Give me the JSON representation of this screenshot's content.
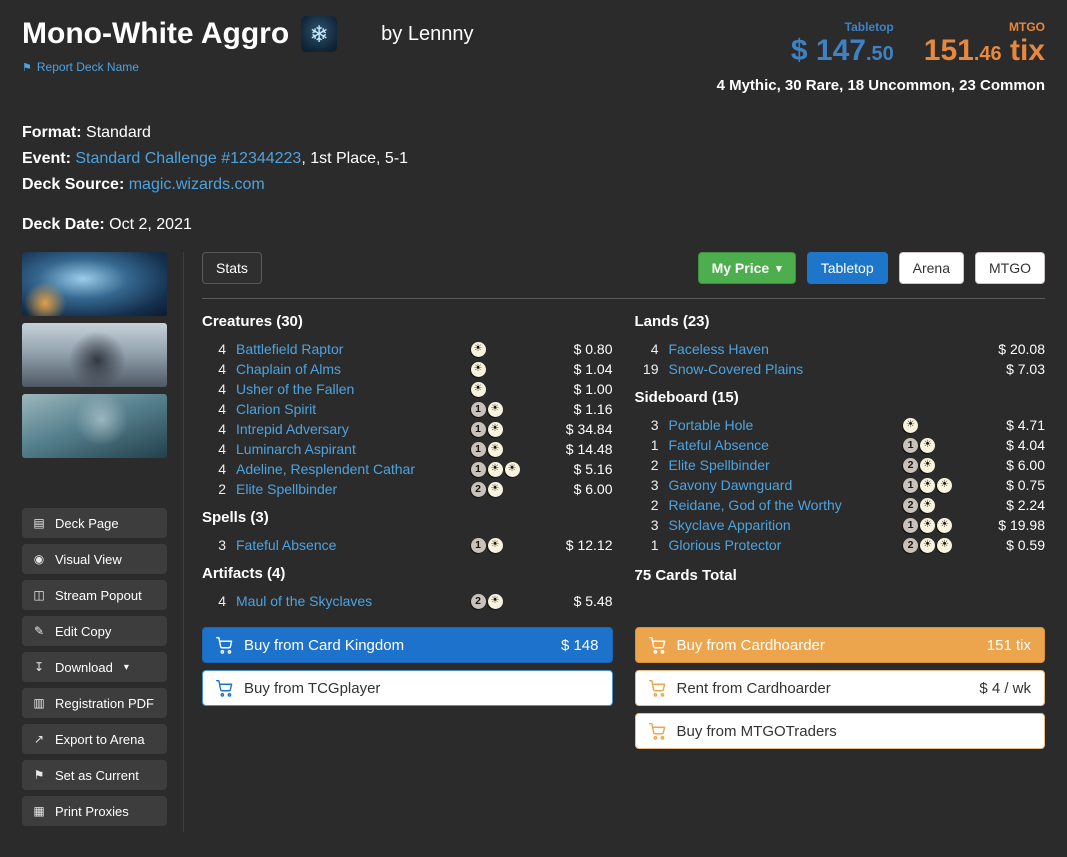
{
  "colors": {
    "background": "#2b2b2b",
    "link_blue": "#4da3e0",
    "tabletop_blue": "#3f82c4",
    "mtgo_orange": "#e8883c",
    "my_price_green": "#4cae4c",
    "active_tab_blue": "#1d76c9",
    "buy_blue": "#1d72cc",
    "buy_orange": "#eda54d",
    "mana_white": "#f7f3dc",
    "mana_generic": "#cac2ba"
  },
  "header": {
    "title": "Mono-White Aggro",
    "snow_icon_glyph": "❄",
    "author": "by Lennny",
    "report_flag_glyph": "⚑",
    "report_link": "Report Deck Name",
    "prices": {
      "tabletop": {
        "label": "Tabletop",
        "currency": "$ ",
        "whole": "147",
        "decimal": ".50"
      },
      "mtgo": {
        "label": "MTGO",
        "whole": "151",
        "decimal": ".46",
        "suffix": " tix"
      }
    },
    "rarity_summary": "4 Mythic, 30 Rare, 18 Uncommon, 23 Common"
  },
  "meta": {
    "format_label": "Format:",
    "format_value": "Standard",
    "event_label": "Event:",
    "event_link": "Standard Challenge #12344223",
    "event_suffix": ", 1st Place, 5-1",
    "source_label": "Deck Source:",
    "source_link": "magic.wizards.com",
    "date_label": "Deck Date:",
    "date_value": "Oct 2, 2021"
  },
  "sidebar": {
    "buttons": [
      {
        "label": "Deck Page",
        "glyph": "▤",
        "icon": "list-icon"
      },
      {
        "label": "Visual View",
        "glyph": "◉",
        "icon": "eye-icon"
      },
      {
        "label": "Stream Popout",
        "glyph": "◫",
        "icon": "popout-icon"
      },
      {
        "label": "Edit Copy",
        "glyph": "✎",
        "icon": "pencil-icon"
      },
      {
        "label": "Download",
        "glyph": "↧",
        "icon": "download-icon",
        "caret": true
      },
      {
        "label": "Registration PDF",
        "glyph": "▥",
        "icon": "document-icon"
      },
      {
        "label": "Export to Arena",
        "glyph": "↗",
        "icon": "export-icon"
      },
      {
        "label": "Set as Current",
        "glyph": "⚑",
        "icon": "flag-icon"
      },
      {
        "label": "Print Proxies",
        "glyph": "▦",
        "icon": "printer-icon"
      }
    ]
  },
  "toolbar": {
    "stats_label": "Stats",
    "my_price_label": "My Price",
    "caret_glyph": "▾",
    "tabletop_label": "Tabletop",
    "arena_label": "Arena",
    "mtgo_label": "MTGO"
  },
  "deck": {
    "columns": [
      {
        "sections": [
          {
            "title": "Creatures (30)",
            "cards": [
              {
                "qty": "4",
                "name": "Battlefield Raptor",
                "mana": [
                  "w"
                ],
                "price": "$ 0.80"
              },
              {
                "qty": "4",
                "name": "Chaplain of Alms",
                "mana": [
                  "w"
                ],
                "price": "$ 1.04"
              },
              {
                "qty": "4",
                "name": "Usher of the Fallen",
                "mana": [
                  "w"
                ],
                "price": "$ 1.00"
              },
              {
                "qty": "4",
                "name": "Clarion Spirit",
                "mana": [
                  "1",
                  "w"
                ],
                "price": "$ 1.16"
              },
              {
                "qty": "4",
                "name": "Intrepid Adversary",
                "mana": [
                  "1",
                  "w"
                ],
                "price": "$ 34.84"
              },
              {
                "qty": "4",
                "name": "Luminarch Aspirant",
                "mana": [
                  "1",
                  "w"
                ],
                "price": "$ 14.48"
              },
              {
                "qty": "4",
                "name": "Adeline, Resplendent Cathar",
                "mana": [
                  "1",
                  "w",
                  "w"
                ],
                "price": "$ 5.16"
              },
              {
                "qty": "2",
                "name": "Elite Spellbinder",
                "mana": [
                  "2",
                  "w"
                ],
                "price": "$ 6.00"
              }
            ]
          },
          {
            "title": "Spells (3)",
            "cards": [
              {
                "qty": "3",
                "name": "Fateful Absence",
                "mana": [
                  "1",
                  "w"
                ],
                "price": "$ 12.12"
              }
            ]
          },
          {
            "title": "Artifacts (4)",
            "cards": [
              {
                "qty": "4",
                "name": "Maul of the Skyclaves",
                "mana": [
                  "2",
                  "w"
                ],
                "price": "$ 5.48"
              }
            ]
          }
        ]
      },
      {
        "sections": [
          {
            "title": "Lands (23)",
            "cards": [
              {
                "qty": "4",
                "name": "Faceless Haven",
                "mana": [],
                "price": "$ 20.08"
              },
              {
                "qty": "19",
                "name": "Snow-Covered Plains",
                "mana": [],
                "price": "$ 7.03"
              }
            ]
          },
          {
            "title": "Sideboard (15)",
            "cards": [
              {
                "qty": "3",
                "name": "Portable Hole",
                "mana": [
                  "w"
                ],
                "price": "$ 4.71"
              },
              {
                "qty": "1",
                "name": "Fateful Absence",
                "mana": [
                  "1",
                  "w"
                ],
                "price": "$ 4.04"
              },
              {
                "qty": "2",
                "name": "Elite Spellbinder",
                "mana": [
                  "2",
                  "w"
                ],
                "price": "$ 6.00"
              },
              {
                "qty": "3",
                "name": "Gavony Dawnguard",
                "mana": [
                  "1",
                  "w",
                  "w"
                ],
                "price": "$ 0.75"
              },
              {
                "qty": "2",
                "name": "Reidane, God of the Worthy",
                "mana": [
                  "2",
                  "w"
                ],
                "price": "$ 2.24"
              },
              {
                "qty": "3",
                "name": "Skyclave Apparition",
                "mana": [
                  "1",
                  "w",
                  "w"
                ],
                "price": "$ 19.98"
              },
              {
                "qty": "1",
                "name": "Glorious Protector",
                "mana": [
                  "2",
                  "w",
                  "w"
                ],
                "price": "$ 0.59"
              }
            ]
          }
        ],
        "footer": "75 Cards Total"
      }
    ]
  },
  "buy": {
    "left": [
      {
        "label": "Buy from Card Kingdom",
        "amount": "$ 148",
        "style": "blue"
      },
      {
        "label": "Buy from TCGplayer",
        "amount": "",
        "style": "white-blue"
      }
    ],
    "right": [
      {
        "label": "Buy from Cardhoarder",
        "amount": "151 tix",
        "style": "orange"
      },
      {
        "label": "Rent from Cardhoarder",
        "amount": "$ 4 / wk",
        "style": "white-orange"
      },
      {
        "label": "Buy from MTGOTraders",
        "amount": "",
        "style": "white-orange"
      }
    ]
  }
}
